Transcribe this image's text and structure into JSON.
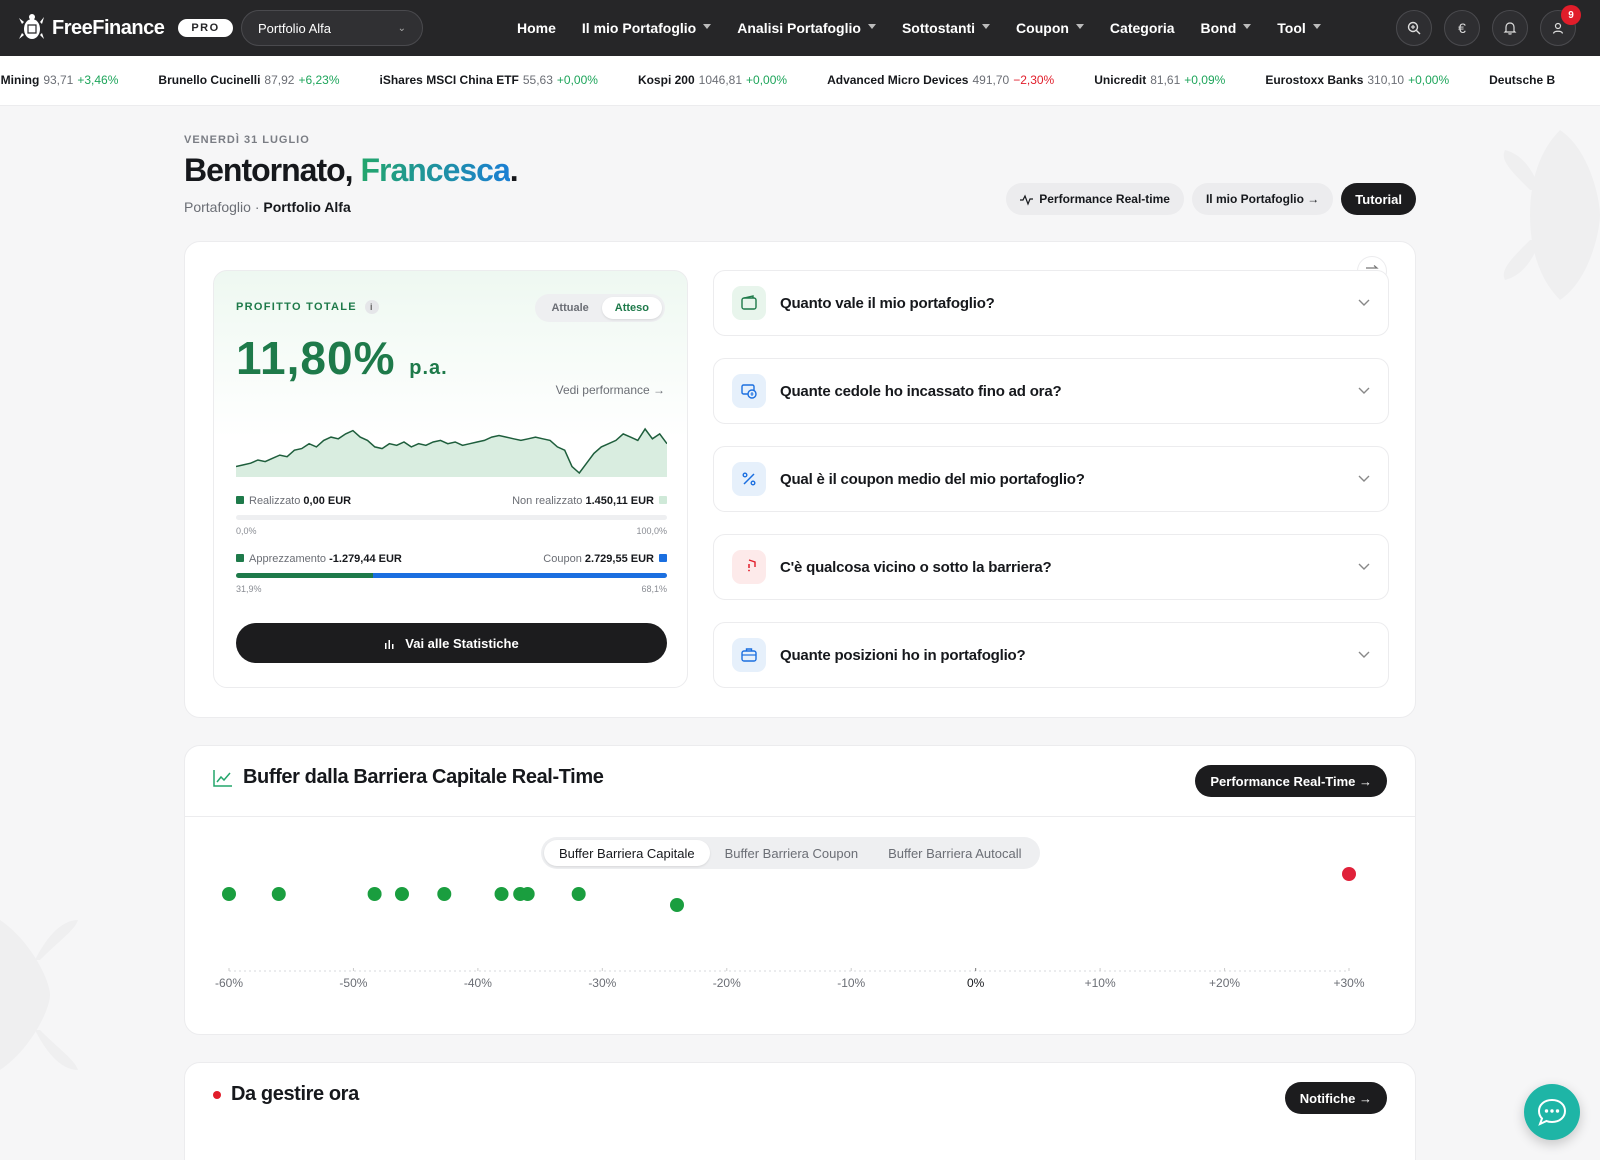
{
  "app": {
    "brand": "FreeFinance",
    "badge": "PRO",
    "portfolio_select": "Portfolio Alfa",
    "nav": [
      {
        "label": "Home",
        "caret": false
      },
      {
        "label": "Il mio Portafoglio",
        "caret": true
      },
      {
        "label": "Analisi Portafoglio",
        "caret": true
      },
      {
        "label": "Sottostanti",
        "caret": true
      },
      {
        "label": "Coupon",
        "caret": true
      },
      {
        "label": "Categoria",
        "caret": false
      },
      {
        "label": "Bond",
        "caret": true
      },
      {
        "label": "Tool",
        "caret": true
      }
    ],
    "icons": [
      "search-zoom-icon",
      "euro-icon",
      "bell-icon",
      "user-icon"
    ],
    "currency_symbol": "€",
    "notifications_count": "9"
  },
  "ticker": [
    {
      "name": "nt Mining",
      "price": "93,71",
      "change": "+3,46%",
      "dir": "pos"
    },
    {
      "name": "Brunello Cucinelli",
      "price": "87,92",
      "change": "+6,23%",
      "dir": "pos"
    },
    {
      "name": "iShares MSCI China ETF",
      "price": "55,63",
      "change": "+0,00%",
      "dir": "pos"
    },
    {
      "name": "Kospi 200",
      "price": "1046,81",
      "change": "+0,00%",
      "dir": "pos"
    },
    {
      "name": "Advanced Micro Devices",
      "price": "491,70",
      "change": "−2,30%",
      "dir": "neg"
    },
    {
      "name": "Unicredit",
      "price": "81,61",
      "change": "+0,09%",
      "dir": "pos"
    },
    {
      "name": "Eurostoxx Banks",
      "price": "310,10",
      "change": "+0,00%",
      "dir": "pos"
    },
    {
      "name": "Deutsche B",
      "price": "",
      "change": "",
      "dir": "pos"
    }
  ],
  "header": {
    "date": "VENERDÌ 31 LUGLIO",
    "greeting": "Bentornato,",
    "name": "Francesca",
    "period": ".",
    "crumb_root": "Portafoglio",
    "crumb_sep": "·",
    "crumb_current": "Portfolio Alfa",
    "actions": {
      "perf": "Performance Real-time",
      "portfolio": "Il mio Portafoglio →",
      "tutorial": "Tutorial"
    }
  },
  "profit": {
    "label": "PROFITTO TOTALE",
    "info": "i",
    "toggle": {
      "option_a": "Attuale",
      "option_b": "Atteso",
      "selected": "Atteso"
    },
    "value": "11,80%",
    "unit": "p.a.",
    "see_performance": "Vedi performance →",
    "realized_label": "Realizzato",
    "realized_value": "0,00 EUR",
    "unrealized_label": "Non realizzato",
    "unrealized_value": "1.450,11 EUR",
    "split1_min": "0,0%",
    "split1_max": "100,0%",
    "split1_fraction": 0.0,
    "appreciation_label": "Apprezzamento",
    "appreciation_value": "-1.279,44 EUR",
    "coupon_label": "Coupon",
    "coupon_value": "2.729,55 EUR",
    "split2_left": "31,9%",
    "split2_right": "68,1%",
    "split2_fraction": 0.319,
    "stats_button": "Vai alle Statistiche",
    "colors": {
      "green": "#1e7a4a",
      "blue": "#1b6fe0",
      "light_green": "#cfe9d8"
    }
  },
  "faq": [
    {
      "text": "Quanto vale il mio portafoglio?",
      "icon": "wallet-icon",
      "bg": "#e8f5ec",
      "fg": "#1e7a4a"
    },
    {
      "text": "Quante cedole ho incassato fino ad ora?",
      "icon": "coupon-cash-icon",
      "bg": "#e6f0fb",
      "fg": "#1b6fe0"
    },
    {
      "text": "Qual è il coupon medio del mio portafoglio?",
      "icon": "percent-icon",
      "bg": "#e6f0fb",
      "fg": "#1b6fe0"
    },
    {
      "text": "C'è qualcosa vicino o sotto la barriera?",
      "icon": "shield-alert-icon",
      "bg": "#fdeaea",
      "fg": "#e11d2a"
    },
    {
      "text": "Quante posizioni ho in portafoglio?",
      "icon": "briefcase-icon",
      "bg": "#e6f0fb",
      "fg": "#1b6fe0"
    }
  ],
  "buffer": {
    "title": "Buffer dalla Barriera Capitale Real-Time",
    "cta": "Performance Real-Time →",
    "tabs": [
      "Buffer Barriera Capitale",
      "Buffer Barriera Coupon",
      "Buffer Barriera Autocall"
    ],
    "active_tab": 0
  },
  "todo": {
    "title": "Da gestire ora",
    "cta": "Notifiche →"
  },
  "chart_data": [
    {
      "type": "line",
      "x": [
        0,
        1,
        2,
        3,
        4,
        5,
        6,
        7,
        8,
        9,
        10,
        11,
        12,
        13,
        14,
        15,
        16,
        17,
        18,
        19,
        20,
        21,
        22,
        23,
        24,
        25,
        26,
        27,
        28,
        29,
        30,
        31,
        32,
        33,
        34,
        35,
        36,
        37,
        38,
        39,
        40,
        41,
        42,
        43,
        44,
        45,
        46,
        47,
        48,
        49,
        50,
        51,
        52,
        53,
        54,
        55,
        56,
        57,
        58,
        59
      ],
      "values": [
        10,
        11,
        12,
        14,
        13,
        15,
        17,
        16,
        20,
        21,
        24,
        22,
        26,
        28,
        27,
        30,
        32,
        28,
        26,
        22,
        21,
        24,
        23,
        25,
        22,
        24,
        23,
        25,
        26,
        24,
        25,
        23,
        24,
        25,
        26,
        28,
        29,
        28,
        27,
        26,
        27,
        28,
        27,
        26,
        22,
        20,
        10,
        6,
        12,
        18,
        22,
        24,
        26,
        30,
        28,
        26,
        33,
        27,
        30,
        24
      ],
      "title": "",
      "xlabel": "",
      "ylabel": ""
    },
    {
      "type": "scatter",
      "title": "",
      "xlabel": "",
      "ylabel": "",
      "xlim": [
        -60,
        30
      ],
      "ticks": [
        -60,
        -50,
        -40,
        -30,
        -20,
        -10,
        0,
        10,
        20,
        30
      ],
      "tick_labels": [
        "-60%",
        "-50%",
        "-40%",
        "-30%",
        "-20%",
        "-10%",
        "0%",
        "+10%",
        "+20%",
        "+30%"
      ],
      "grid": false,
      "points": [
        {
          "x": -60.0,
          "row": 1,
          "color": "#1a9e3f"
        },
        {
          "x": -56.0,
          "row": 1,
          "color": "#1a9e3f"
        },
        {
          "x": -48.3,
          "row": 1,
          "color": "#1a9e3f"
        },
        {
          "x": -46.1,
          "row": 1,
          "color": "#1a9e3f"
        },
        {
          "x": -42.7,
          "row": 1,
          "color": "#1a9e3f"
        },
        {
          "x": -38.1,
          "row": 1,
          "color": "#1a9e3f"
        },
        {
          "x": -36.6,
          "row": 1,
          "color": "#1a9e3f"
        },
        {
          "x": -36.0,
          "row": 1,
          "color": "#1a9e3f"
        },
        {
          "x": -31.9,
          "row": 1,
          "color": "#1a9e3f"
        },
        {
          "x": -24.0,
          "row": 2,
          "color": "#1a9e3f"
        },
        {
          "x": 30.0,
          "row": 0,
          "color": "#e0213a"
        }
      ]
    }
  ]
}
